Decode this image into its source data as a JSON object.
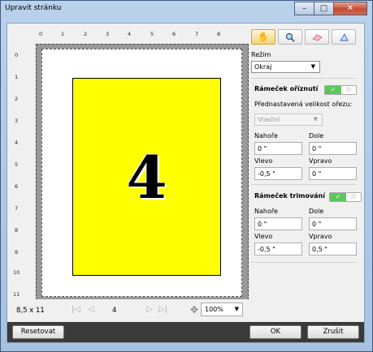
{
  "window": {
    "title": "Upravit stránku",
    "minimize": "–",
    "maximize": "□",
    "close": "✕"
  },
  "preview": {
    "ruler_top": [
      "0",
      "1",
      "2",
      "3",
      "4",
      "5",
      "6",
      "7",
      "8"
    ],
    "ruler_left": [
      "0",
      "1",
      "2",
      "3",
      "4",
      "5",
      "6",
      "7",
      "8",
      "9",
      "10",
      "11"
    ],
    "page_number_big": "4"
  },
  "navbar": {
    "page_size": "8,5 x 11",
    "first": "|◁",
    "prev": "◁",
    "page": "4",
    "next": "▷",
    "last": "▷|",
    "zoom": "100%"
  },
  "panel": {
    "mode_label": "Režim",
    "mode_value": "Okraj",
    "crop_title": "Rámeček oříznutí",
    "preset_label": "Přednastavená velikost ořezu:",
    "preset_value": "Vlastní",
    "crop": {
      "top_label": "Nahoře",
      "bottom_label": "Dole",
      "left_label": "Vlevo",
      "right_label": "Vpravo",
      "top": "0 \"",
      "bottom": "0 \"",
      "left": "-0,5 \"",
      "right": "0 \""
    },
    "trim_title": "Rámeček trimování",
    "trim": {
      "top_label": "Nahoře",
      "bottom_label": "Dole",
      "left_label": "Vlevo",
      "right_label": "Vpravo",
      "top": "0 \"",
      "bottom": "0 \"",
      "left": "-0,5 \"",
      "right": "0,5 \""
    },
    "toggle_on": "✓"
  },
  "footer": {
    "reset": "Resetovat",
    "ok": "OK",
    "cancel": "Zrušit"
  }
}
